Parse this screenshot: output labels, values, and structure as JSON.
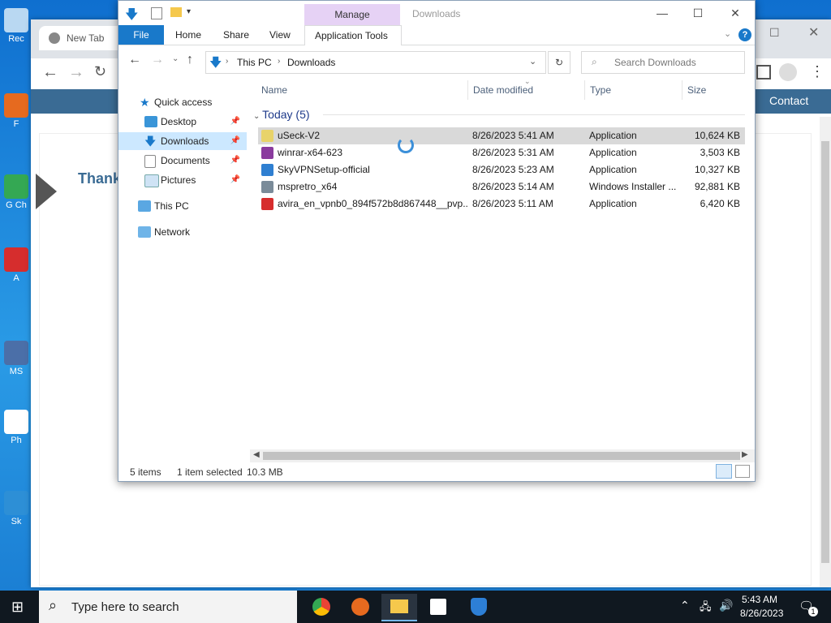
{
  "desktop": {
    "icons": [
      {
        "label": "Rec",
        "color": "#b9d8f2"
      },
      {
        "label": "F",
        "color": "#e66a1f"
      },
      {
        "label": "G Ch",
        "color": "#34a853"
      },
      {
        "label": "A",
        "color": "#d62d2d"
      },
      {
        "label": "MS",
        "color": "#4b6fa8"
      },
      {
        "label": "Ph",
        "color": "#ffffff"
      },
      {
        "label": "Sk",
        "color": "#2d8fd6"
      }
    ]
  },
  "chrome": {
    "tab_label": "New Tab",
    "header_link": "Contact",
    "page_heading": "Thank"
  },
  "explorer": {
    "title": "Downloads",
    "manage_label": "Manage",
    "ribbon_tabs": [
      "File",
      "Home",
      "Share",
      "View",
      "Application Tools"
    ],
    "breadcrumb": [
      "This PC",
      "Downloads"
    ],
    "search_placeholder": "Search Downloads",
    "nav": {
      "quick_access": "Quick access",
      "items": [
        {
          "label": "Desktop",
          "pinned": true
        },
        {
          "label": "Downloads",
          "pinned": true,
          "selected": true
        },
        {
          "label": "Documents",
          "pinned": true
        },
        {
          "label": "Pictures",
          "pinned": true
        }
      ],
      "this_pc": "This PC",
      "network": "Network"
    },
    "columns": {
      "name": "Name",
      "date": "Date modified",
      "type": "Type",
      "size": "Size"
    },
    "group": "Today (5)",
    "files": [
      {
        "name": "uSeck-V2",
        "date": "8/26/2023 5:41 AM",
        "type": "Application",
        "size": "10,624 KB",
        "icon_color": "#e8d36a",
        "selected": true
      },
      {
        "name": "winrar-x64-623",
        "date": "8/26/2023 5:31 AM",
        "type": "Application",
        "size": "3,503 KB",
        "icon_color": "#8a3b9e",
        "selected": false
      },
      {
        "name": "SkyVPNSetup-official",
        "date": "8/26/2023 5:23 AM",
        "type": "Application",
        "size": "10,327 KB",
        "icon_color": "#2f7fd1",
        "selected": false
      },
      {
        "name": "mspretro_x64",
        "date": "8/26/2023 5:14 AM",
        "type": "Windows Installer ...",
        "size": "92,881 KB",
        "icon_color": "#7a8b99",
        "selected": false
      },
      {
        "name": "avira_en_vpnb0_894f572b8d867448__pvp...",
        "date": "8/26/2023 5:11 AM",
        "type": "Application",
        "size": "6,420 KB",
        "icon_color": "#d62d2d",
        "selected": false
      }
    ],
    "status": {
      "items": "5 items",
      "selected": "1 item selected",
      "size": "10.3 MB"
    }
  },
  "taskbar": {
    "search_placeholder": "Type here to search",
    "time": "5:43 AM",
    "date": "8/26/2023",
    "notification_count": "1"
  }
}
